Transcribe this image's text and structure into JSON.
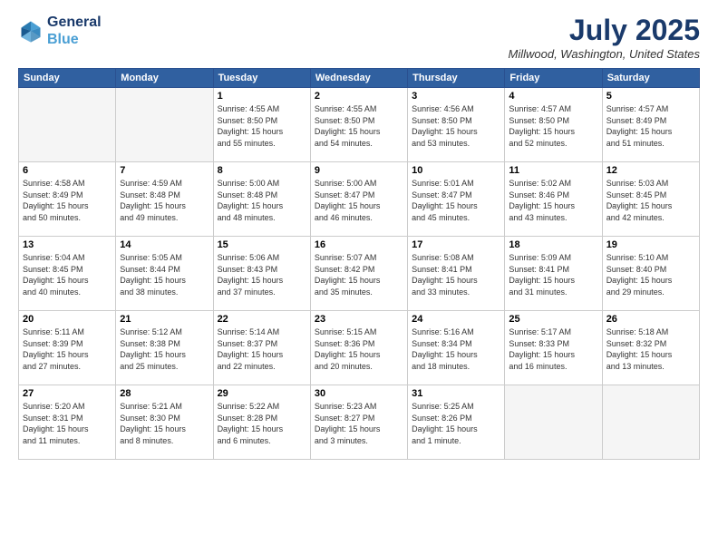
{
  "header": {
    "logo_line1": "General",
    "logo_line2": "Blue",
    "month_title": "July 2025",
    "location": "Millwood, Washington, United States"
  },
  "weekdays": [
    "Sunday",
    "Monday",
    "Tuesday",
    "Wednesday",
    "Thursday",
    "Friday",
    "Saturday"
  ],
  "weeks": [
    [
      {
        "day": "",
        "info": ""
      },
      {
        "day": "",
        "info": ""
      },
      {
        "day": "1",
        "info": "Sunrise: 4:55 AM\nSunset: 8:50 PM\nDaylight: 15 hours\nand 55 minutes."
      },
      {
        "day": "2",
        "info": "Sunrise: 4:55 AM\nSunset: 8:50 PM\nDaylight: 15 hours\nand 54 minutes."
      },
      {
        "day": "3",
        "info": "Sunrise: 4:56 AM\nSunset: 8:50 PM\nDaylight: 15 hours\nand 53 minutes."
      },
      {
        "day": "4",
        "info": "Sunrise: 4:57 AM\nSunset: 8:50 PM\nDaylight: 15 hours\nand 52 minutes."
      },
      {
        "day": "5",
        "info": "Sunrise: 4:57 AM\nSunset: 8:49 PM\nDaylight: 15 hours\nand 51 minutes."
      }
    ],
    [
      {
        "day": "6",
        "info": "Sunrise: 4:58 AM\nSunset: 8:49 PM\nDaylight: 15 hours\nand 50 minutes."
      },
      {
        "day": "7",
        "info": "Sunrise: 4:59 AM\nSunset: 8:48 PM\nDaylight: 15 hours\nand 49 minutes."
      },
      {
        "day": "8",
        "info": "Sunrise: 5:00 AM\nSunset: 8:48 PM\nDaylight: 15 hours\nand 48 minutes."
      },
      {
        "day": "9",
        "info": "Sunrise: 5:00 AM\nSunset: 8:47 PM\nDaylight: 15 hours\nand 46 minutes."
      },
      {
        "day": "10",
        "info": "Sunrise: 5:01 AM\nSunset: 8:47 PM\nDaylight: 15 hours\nand 45 minutes."
      },
      {
        "day": "11",
        "info": "Sunrise: 5:02 AM\nSunset: 8:46 PM\nDaylight: 15 hours\nand 43 minutes."
      },
      {
        "day": "12",
        "info": "Sunrise: 5:03 AM\nSunset: 8:45 PM\nDaylight: 15 hours\nand 42 minutes."
      }
    ],
    [
      {
        "day": "13",
        "info": "Sunrise: 5:04 AM\nSunset: 8:45 PM\nDaylight: 15 hours\nand 40 minutes."
      },
      {
        "day": "14",
        "info": "Sunrise: 5:05 AM\nSunset: 8:44 PM\nDaylight: 15 hours\nand 38 minutes."
      },
      {
        "day": "15",
        "info": "Sunrise: 5:06 AM\nSunset: 8:43 PM\nDaylight: 15 hours\nand 37 minutes."
      },
      {
        "day": "16",
        "info": "Sunrise: 5:07 AM\nSunset: 8:42 PM\nDaylight: 15 hours\nand 35 minutes."
      },
      {
        "day": "17",
        "info": "Sunrise: 5:08 AM\nSunset: 8:41 PM\nDaylight: 15 hours\nand 33 minutes."
      },
      {
        "day": "18",
        "info": "Sunrise: 5:09 AM\nSunset: 8:41 PM\nDaylight: 15 hours\nand 31 minutes."
      },
      {
        "day": "19",
        "info": "Sunrise: 5:10 AM\nSunset: 8:40 PM\nDaylight: 15 hours\nand 29 minutes."
      }
    ],
    [
      {
        "day": "20",
        "info": "Sunrise: 5:11 AM\nSunset: 8:39 PM\nDaylight: 15 hours\nand 27 minutes."
      },
      {
        "day": "21",
        "info": "Sunrise: 5:12 AM\nSunset: 8:38 PM\nDaylight: 15 hours\nand 25 minutes."
      },
      {
        "day": "22",
        "info": "Sunrise: 5:14 AM\nSunset: 8:37 PM\nDaylight: 15 hours\nand 22 minutes."
      },
      {
        "day": "23",
        "info": "Sunrise: 5:15 AM\nSunset: 8:36 PM\nDaylight: 15 hours\nand 20 minutes."
      },
      {
        "day": "24",
        "info": "Sunrise: 5:16 AM\nSunset: 8:34 PM\nDaylight: 15 hours\nand 18 minutes."
      },
      {
        "day": "25",
        "info": "Sunrise: 5:17 AM\nSunset: 8:33 PM\nDaylight: 15 hours\nand 16 minutes."
      },
      {
        "day": "26",
        "info": "Sunrise: 5:18 AM\nSunset: 8:32 PM\nDaylight: 15 hours\nand 13 minutes."
      }
    ],
    [
      {
        "day": "27",
        "info": "Sunrise: 5:20 AM\nSunset: 8:31 PM\nDaylight: 15 hours\nand 11 minutes."
      },
      {
        "day": "28",
        "info": "Sunrise: 5:21 AM\nSunset: 8:30 PM\nDaylight: 15 hours\nand 8 minutes."
      },
      {
        "day": "29",
        "info": "Sunrise: 5:22 AM\nSunset: 8:28 PM\nDaylight: 15 hours\nand 6 minutes."
      },
      {
        "day": "30",
        "info": "Sunrise: 5:23 AM\nSunset: 8:27 PM\nDaylight: 15 hours\nand 3 minutes."
      },
      {
        "day": "31",
        "info": "Sunrise: 5:25 AM\nSunset: 8:26 PM\nDaylight: 15 hours\nand 1 minute."
      },
      {
        "day": "",
        "info": ""
      },
      {
        "day": "",
        "info": ""
      }
    ]
  ]
}
